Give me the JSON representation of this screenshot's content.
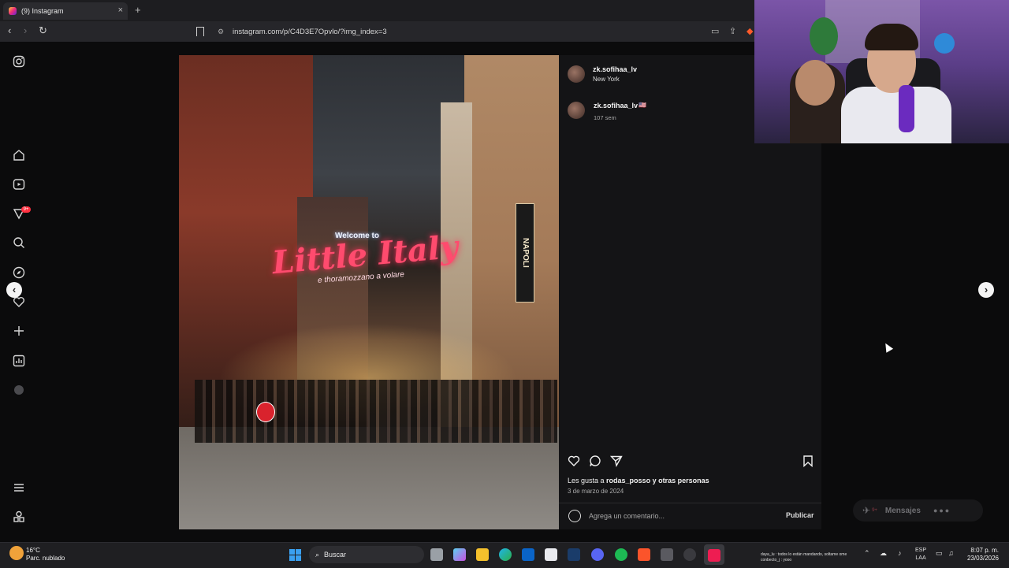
{
  "browser": {
    "tab_title": "(9) Instagram",
    "tab_close": "×",
    "new_tab": "+",
    "back": "‹",
    "forward": "›",
    "reload": "↻",
    "url": "instagram.com/p/C4D3E7Opvlo/?img_index=3"
  },
  "post": {
    "photo_sign_top": "Welcome to",
    "photo_sign_main": "Little Italy",
    "photo_sign_sub": "e thoramozzano a volare",
    "photo_sign_napoli": "NAPOLI",
    "author": {
      "username": "zk.sofihaa_lv",
      "location": "New York"
    },
    "caption": {
      "username": "zk.sofihaa_lv",
      "text": "🇺🇸",
      "age": "107 sem"
    },
    "likes": {
      "prefix": "Les gusta a ",
      "user": "rodas_posso",
      "suffix": " y otras personas"
    },
    "date": "3 de marzo de 2024",
    "comment_placeholder": "Agrega un comentario...",
    "publish_label": "Publicar",
    "prev_arrow": "‹",
    "next_arrow": "›"
  },
  "messages": {
    "label": "Mensajes",
    "badge": "9+"
  },
  "rail": {
    "notification_badge": "9+"
  },
  "taskbar": {
    "weather_temp": "16°C",
    "weather_desc": "Parc. nublado",
    "search_label": "Buscar",
    "tray_message_line1": "daya_lu : todos lo están mandando, soltame ome",
    "tray_message_line2": "conbecto_j : yooo",
    "lang_line1": "ESP",
    "lang_line2": "LAA",
    "time": "8:07 p. m.",
    "date": "23/03/2026"
  },
  "colors": {
    "background": "#0b0b0c",
    "panel": "#141416",
    "accent_red": "#ff3040",
    "windows_blue": "#3aa0f0"
  }
}
